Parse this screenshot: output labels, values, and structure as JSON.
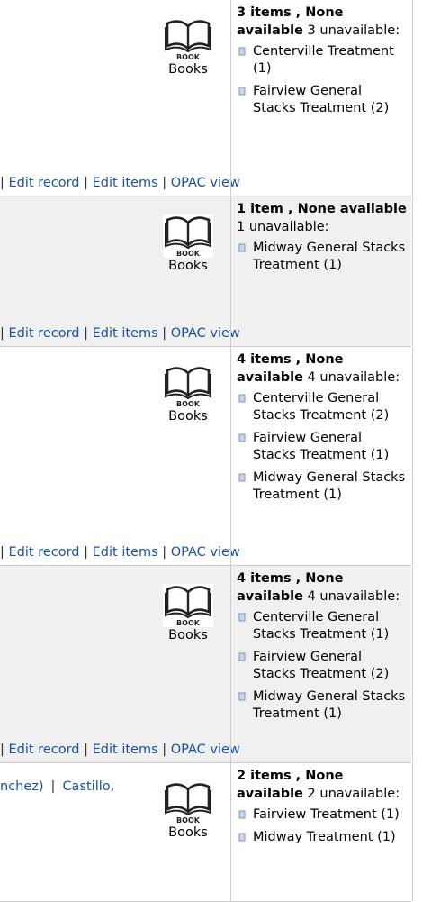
{
  "records": [
    {
      "format": "Books",
      "format_icon_text": "BOOK",
      "authors_left": "",
      "authors_right": "",
      "links": {
        "sep": "|",
        "edit_record": "Edit record",
        "edit_items": "Edit items",
        "opac": "OPAC view"
      },
      "items_bold": "3 items , None available",
      "items_rest": " 3 unavailable:",
      "locations": [
        "Centerville Treatment (1)",
        "Fairview General Stacks Treatment (2)"
      ]
    },
    {
      "format": "Books",
      "format_icon_text": "BOOK",
      "links": {
        "sep": "|",
        "edit_record": "Edit record",
        "edit_items": "Edit items",
        "opac": "OPAC view"
      },
      "items_bold": "1 item , None available",
      "items_rest": " 1 unavailable:",
      "locations": [
        "Midway General Stacks Treatment (1)"
      ]
    },
    {
      "format": "Books",
      "format_icon_text": "BOOK",
      "links": {
        "sep": "|",
        "edit_record": "Edit record",
        "edit_items": "Edit items",
        "opac": "OPAC view"
      },
      "items_bold": "4 items , None available",
      "items_rest": " 4 unavailable:",
      "locations": [
        "Centerville General Stacks Treatment (2)",
        "Fairview General Stacks Treatment (1)",
        "Midway General Stacks Treatment (1)"
      ]
    },
    {
      "format": "Books",
      "format_icon_text": "BOOK",
      "links": {
        "sep": "|",
        "edit_record": "Edit record",
        "edit_items": "Edit items",
        "opac": "OPAC view"
      },
      "items_bold": "4 items , None available",
      "items_rest": " 4 unavailable:",
      "locations": [
        "Centerville General Stacks Treatment (1)",
        "Fairview General Stacks Treatment (2)",
        "Midway General Stacks Treatment (1)"
      ]
    },
    {
      "format": "Books",
      "format_icon_text": "BOOK",
      "authors_left": "nchez)",
      "author_sep": "|",
      "authors_right": "Castillo,",
      "items_bold": "2 items , None available",
      "items_rest": " 2 unavailable:",
      "locations": [
        "Fairview Treatment (1)",
        "Midway Treatment (1)"
      ]
    }
  ],
  "colors": {
    "link": "#1a52a6",
    "shaded_row": "#f0f0f0",
    "border": "#cccccc"
  }
}
